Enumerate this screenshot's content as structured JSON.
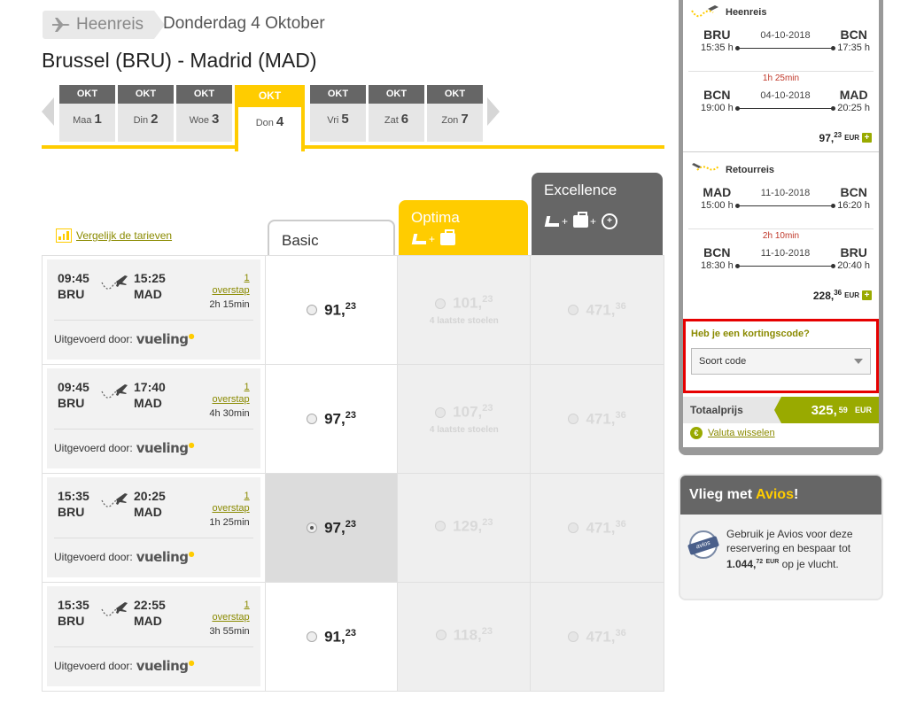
{
  "header": {
    "leg_label": "Heenreis",
    "date": "Donderdag 4 Oktober",
    "route": "Brussel (BRU) - Madrid (MAD)"
  },
  "date_tabs": [
    {
      "month": "OKT",
      "day": "Maa",
      "num": "1"
    },
    {
      "month": "OKT",
      "day": "Din",
      "num": "2"
    },
    {
      "month": "OKT",
      "day": "Woe",
      "num": "3"
    },
    {
      "month": "OKT",
      "day": "Don",
      "num": "4",
      "active": true
    },
    {
      "month": "OKT",
      "day": "Vri",
      "num": "5"
    },
    {
      "month": "OKT",
      "day": "Zat",
      "num": "6"
    },
    {
      "month": "OKT",
      "day": "Zon",
      "num": "7"
    }
  ],
  "compare_link": "Vergelijk de tarieven",
  "fare_columns": {
    "basic": "Basic",
    "optima": "Optima",
    "excellence": "Excellence"
  },
  "flights": [
    {
      "dep_time": "09:45",
      "dep": "BRU",
      "arr_time": "15:25",
      "arr": "MAD",
      "stops_num": "1",
      "stops_label": "overstap",
      "duration": "2h  15min",
      "operator_label": "Uitgevoerd door:",
      "operator": "vueling",
      "basic": {
        "int": "91,",
        "dec": "23"
      },
      "optima": {
        "int": "101,",
        "dec": "23",
        "note": "4 laatste stoelen"
      },
      "excellence": {
        "int": "471,",
        "dec": "36"
      },
      "selected": false
    },
    {
      "dep_time": "09:45",
      "dep": "BRU",
      "arr_time": "17:40",
      "arr": "MAD",
      "stops_num": "1",
      "stops_label": "overstap",
      "duration": "4h  30min",
      "operator_label": "Uitgevoerd door:",
      "operator": "vueling",
      "basic": {
        "int": "97,",
        "dec": "23"
      },
      "optima": {
        "int": "107,",
        "dec": "23",
        "note": "4 laatste stoelen"
      },
      "excellence": {
        "int": "471,",
        "dec": "36"
      },
      "selected": false
    },
    {
      "dep_time": "15:35",
      "dep": "BRU",
      "arr_time": "20:25",
      "arr": "MAD",
      "stops_num": "1",
      "stops_label": "overstap",
      "duration": "1h  25min",
      "operator_label": "Uitgevoerd door:",
      "operator": "vueling",
      "basic": {
        "int": "97,",
        "dec": "23"
      },
      "optima": {
        "int": "129,",
        "dec": "23",
        "note": ""
      },
      "excellence": {
        "int": "471,",
        "dec": "36"
      },
      "selected": true
    },
    {
      "dep_time": "15:35",
      "dep": "BRU",
      "arr_time": "22:55",
      "arr": "MAD",
      "stops_num": "1",
      "stops_label": "overstap",
      "duration": "3h  55min",
      "operator_label": "Uitgevoerd door:",
      "operator": "vueling",
      "basic": {
        "int": "91,",
        "dec": "23"
      },
      "optima": {
        "int": "118,",
        "dec": "23",
        "note": ""
      },
      "excellence": {
        "int": "471,",
        "dec": "36"
      },
      "selected": false
    }
  ],
  "summary": {
    "outbound": {
      "label": "Heenreis",
      "seg1": {
        "from": "BRU",
        "from_time": "15:35 h",
        "date": "04-10-2018",
        "to": "BCN",
        "to_time": "17:35 h"
      },
      "layover": "1h  25min",
      "seg2": {
        "from": "BCN",
        "from_time": "19:00 h",
        "date": "04-10-2018",
        "to": "MAD",
        "to_time": "20:25 h"
      },
      "total_int": "97,",
      "total_dec": "23",
      "currency": "EUR"
    },
    "return": {
      "label": "Retourreis",
      "seg1": {
        "from": "MAD",
        "from_time": "15:00 h",
        "date": "11-10-2018",
        "to": "BCN",
        "to_time": "16:20 h"
      },
      "layover": "2h  10min",
      "seg2": {
        "from": "BCN",
        "from_time": "18:30 h",
        "date": "11-10-2018",
        "to": "BRU",
        "to_time": "20:40 h"
      },
      "total_int": "228,",
      "total_dec": "36",
      "currency": "EUR"
    },
    "promo_title": "Heb je een kortingscode?",
    "promo_select": "Soort code",
    "total_label": "Totaalprijs",
    "total_int": "325,",
    "total_dec": "59",
    "total_currency": "EUR",
    "currency_link": "Valuta wisselen"
  },
  "avios": {
    "title_pre": "Vlieg met ",
    "title_brand": "Avios",
    "title_post": "!",
    "logo_text": "avios",
    "text_1": "Gebruik je Avios voor deze reservering en bespaar tot ",
    "amount_int": "1.044,",
    "amount_dec": "72",
    "amount_cur": "EUR",
    "text_2": " op je vlucht."
  },
  "colors": {
    "accent": "#ffcc00",
    "dark": "#666666",
    "green": "#99aa00",
    "promo_border": "#e60000"
  }
}
